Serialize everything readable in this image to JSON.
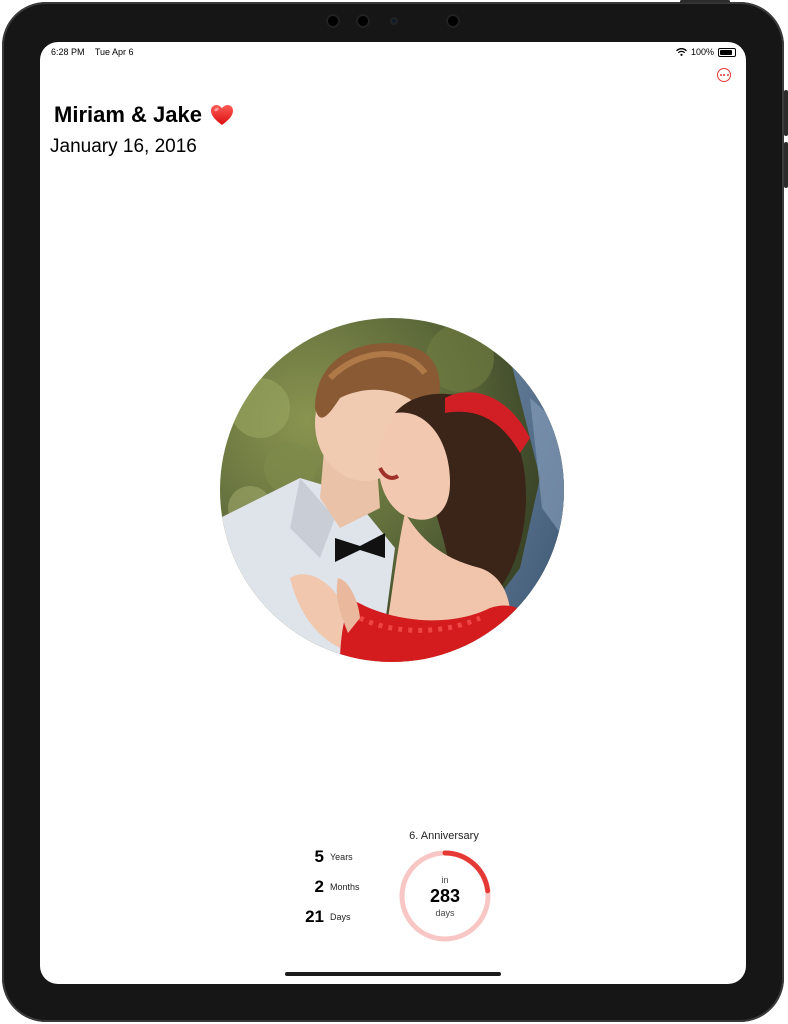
{
  "status_bar": {
    "time": "6:28 PM",
    "date": "Tue Apr 6",
    "battery": "100%"
  },
  "header": {
    "title": "Miriam & Jake",
    "date": "January 16, 2016",
    "emoji_icon": "heart-icon"
  },
  "menu": {
    "icon": "ellipsis-icon"
  },
  "photo": {
    "subject": "couple-photo"
  },
  "duration": [
    {
      "value": "5",
      "unit": "Years"
    },
    {
      "value": "2",
      "unit": "Months"
    },
    {
      "value": "21",
      "unit": "Days"
    }
  ],
  "anniversary": {
    "title": "6. Anniversary",
    "prefix": "in",
    "count": "283",
    "suffix": "days",
    "progress": 0.23
  },
  "colors": {
    "accent": "#e53935",
    "ring_track": "#f8c7c5"
  }
}
